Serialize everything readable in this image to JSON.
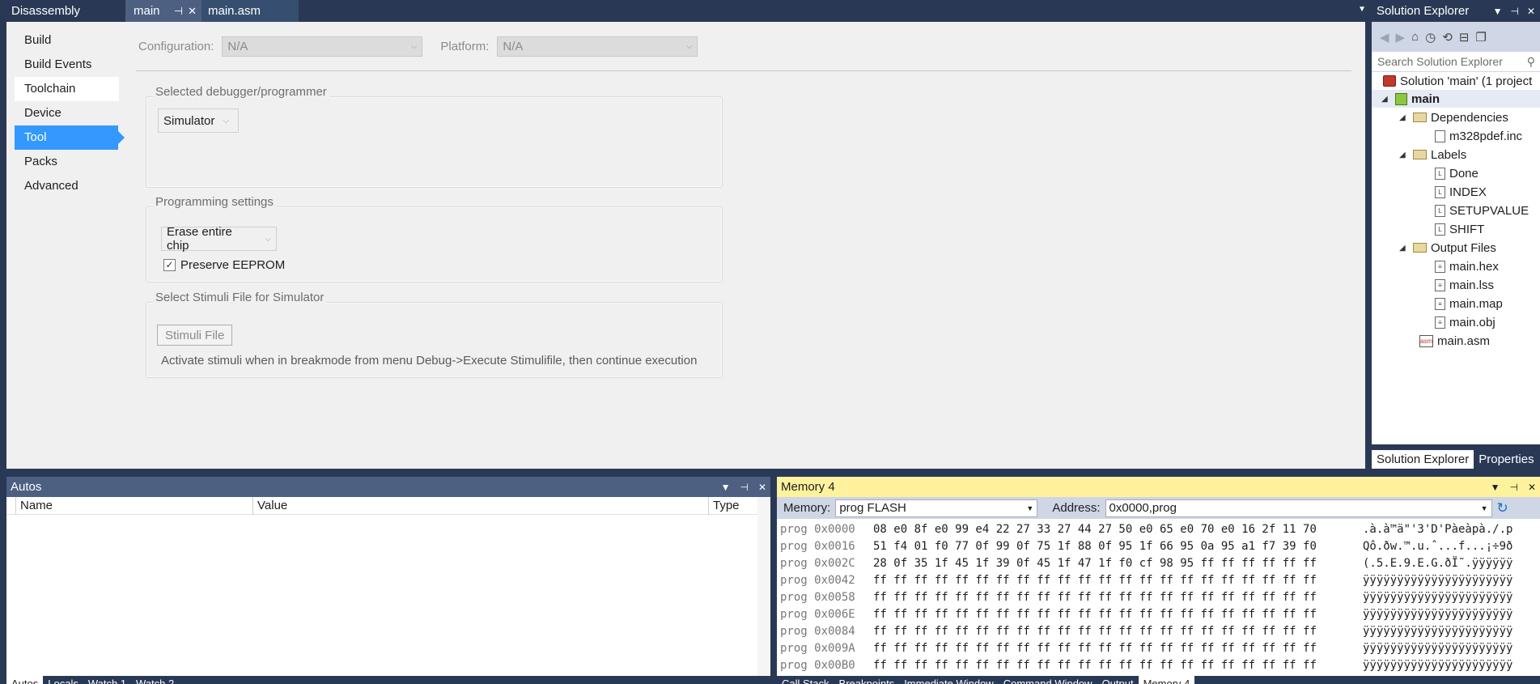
{
  "doc_tabs": {
    "first": "Disassembly",
    "active": "main",
    "second": "main.asm"
  },
  "props": {
    "nav": [
      "Build",
      "Build Events",
      "Toolchain",
      "Device",
      "Tool",
      "Packs",
      "Advanced"
    ],
    "configuration_label": "Configuration:",
    "configuration_value": "N/A",
    "platform_label": "Platform:",
    "platform_value": "N/A",
    "debugger_group": "Selected debugger/programmer",
    "debugger_value": "Simulator",
    "programming_group": "Programming settings",
    "erase_value": "Erase entire chip",
    "preserve_eeprom": "Preserve EEPROM",
    "stimuli_group": "Select Stimuli File for Simulator",
    "stimuli_button": "Stimuli File",
    "stimuli_hint": "Activate stimuli when in breakmode from menu Debug->Execute Stimulifile, then continue execution"
  },
  "solution_explorer": {
    "title": "Solution Explorer",
    "search_placeholder": "Search Solution Explorer",
    "solution": "Solution 'main' (1 project",
    "project": "main",
    "dependencies": "Dependencies",
    "dep_file": "m328pdef.inc",
    "labels": "Labels",
    "label_items": [
      "Done",
      "INDEX",
      "SETUPVALUE",
      "SHIFT"
    ],
    "output_files": "Output Files",
    "output_items": [
      "main.hex",
      "main.lss",
      "main.map",
      "main.obj"
    ],
    "asm_file": "main.asm",
    "tab_se": "Solution Explorer",
    "tab_props": "Properties"
  },
  "autos": {
    "title": "Autos",
    "col_name": "Name",
    "col_value": "Value",
    "col_type": "Type"
  },
  "memory": {
    "title": "Memory 4",
    "memory_label": "Memory:",
    "memory_value": "prog FLASH",
    "address_label": "Address:",
    "address_value": "0x0000,prog",
    "rows": [
      {
        "addr": "prog 0x0000",
        "hex": "08 e0 8f e0 99 e4 22 27 33 27 44 27 50 e0 65 e0 70 e0 16 2f 11 70",
        "ascii": ".à.à™ä\"'3'D'Pàeàpà./.p"
      },
      {
        "addr": "prog 0x0016",
        "hex": "51 f4 01 f0 77 0f 99 0f 75 1f 88 0f 95 1f 66 95 0a 95 a1 f7 39 f0",
        "ascii": "Qô.ðw.™.u.ˆ...f...¡÷9ð"
      },
      {
        "addr": "prog 0x002C",
        "hex": "28 0f 35 1f 45 1f 39 0f 45 1f 47 1f f0 cf 98 95 ff ff ff ff ff ff",
        "ascii": "(.5.E.9.E.G.ðÏ˜.ÿÿÿÿÿÿ"
      },
      {
        "addr": "prog 0x0042",
        "hex": "ff ff ff ff ff ff ff ff ff ff ff ff ff ff ff ff ff ff ff ff ff ff",
        "ascii": "ÿÿÿÿÿÿÿÿÿÿÿÿÿÿÿÿÿÿÿÿÿÿ"
      },
      {
        "addr": "prog 0x0058",
        "hex": "ff ff ff ff ff ff ff ff ff ff ff ff ff ff ff ff ff ff ff ff ff ff",
        "ascii": "ÿÿÿÿÿÿÿÿÿÿÿÿÿÿÿÿÿÿÿÿÿÿ"
      },
      {
        "addr": "prog 0x006E",
        "hex": "ff ff ff ff ff ff ff ff ff ff ff ff ff ff ff ff ff ff ff ff ff ff",
        "ascii": "ÿÿÿÿÿÿÿÿÿÿÿÿÿÿÿÿÿÿÿÿÿÿ"
      },
      {
        "addr": "prog 0x0084",
        "hex": "ff ff ff ff ff ff ff ff ff ff ff ff ff ff ff ff ff ff ff ff ff ff",
        "ascii": "ÿÿÿÿÿÿÿÿÿÿÿÿÿÿÿÿÿÿÿÿÿÿ"
      },
      {
        "addr": "prog 0x009A",
        "hex": "ff ff ff ff ff ff ff ff ff ff ff ff ff ff ff ff ff ff ff ff ff ff",
        "ascii": "ÿÿÿÿÿÿÿÿÿÿÿÿÿÿÿÿÿÿÿÿÿÿ"
      },
      {
        "addr": "prog 0x00B0",
        "hex": "ff ff ff ff ff ff ff ff ff ff ff ff ff ff ff ff ff ff ff ff ff ff",
        "ascii": "ÿÿÿÿÿÿÿÿÿÿÿÿÿÿÿÿÿÿÿÿÿÿ"
      }
    ]
  },
  "bottom_tabs_left": [
    "Autos",
    "Locals",
    "Watch 1",
    "Watch 2"
  ],
  "bottom_tabs_right": [
    "Call Stack",
    "Breakpoints",
    "Immediate Window",
    "Command Window",
    "Output",
    "Memory 4"
  ]
}
